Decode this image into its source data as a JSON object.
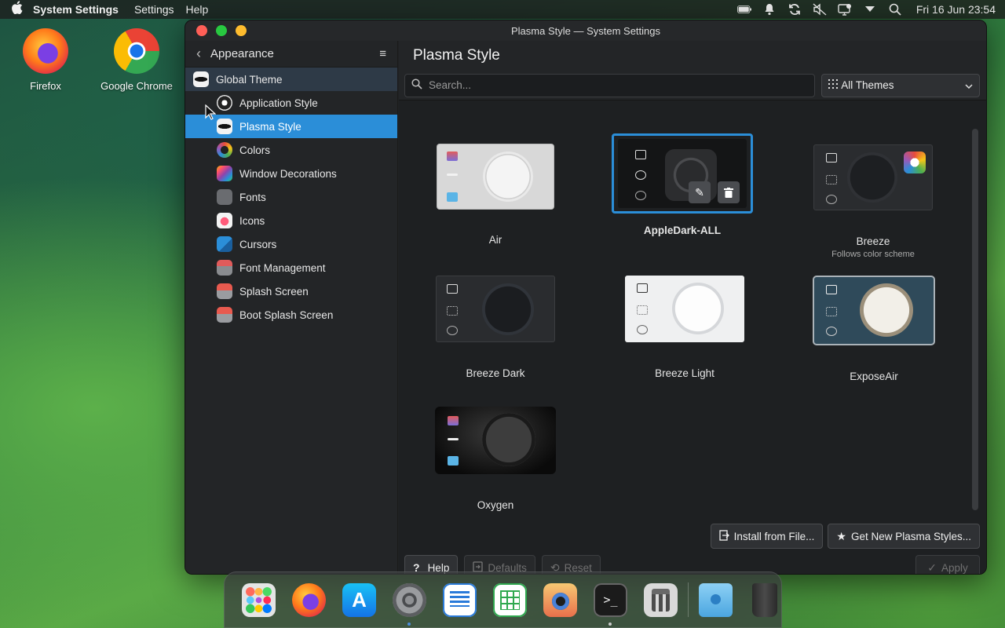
{
  "menubar": {
    "app_name": "System Settings",
    "menus": [
      "Settings",
      "Help"
    ],
    "clock": "Fri 16 Jun 23:54"
  },
  "desktop": {
    "icons": [
      {
        "label": "Firefox"
      },
      {
        "label": "Google Chrome"
      }
    ]
  },
  "window": {
    "title": "Plasma Style — System Settings"
  },
  "sidebar": {
    "header": "Appearance",
    "top_item": "Global Theme",
    "items": [
      {
        "label": "Application Style"
      },
      {
        "label": "Plasma Style"
      },
      {
        "label": "Colors"
      },
      {
        "label": "Window Decorations"
      },
      {
        "label": "Fonts"
      },
      {
        "label": "Icons"
      },
      {
        "label": "Cursors"
      },
      {
        "label": "Font Management"
      },
      {
        "label": "Splash Screen"
      },
      {
        "label": "Boot Splash Screen"
      }
    ],
    "selected": "Plasma Style"
  },
  "main": {
    "title": "Plasma Style",
    "search_placeholder": "Search...",
    "filter": "All Themes",
    "themes": [
      {
        "name": "Air",
        "subtitle": ""
      },
      {
        "name": "AppleDark-ALL",
        "subtitle": ""
      },
      {
        "name": "Breeze",
        "subtitle": "Follows color scheme"
      },
      {
        "name": "Breeze Dark",
        "subtitle": ""
      },
      {
        "name": "Breeze Light",
        "subtitle": ""
      },
      {
        "name": "ExposeAir",
        "subtitle": ""
      },
      {
        "name": "Oxygen",
        "subtitle": ""
      }
    ],
    "selected_theme": "AppleDark-ALL",
    "install_label": "Install from File...",
    "get_new_label": "Get New Plasma Styles...",
    "help_label": "Help",
    "defaults_label": "Defaults",
    "reset_label": "Reset",
    "apply_label": "Apply"
  },
  "colors": {
    "accent": "#2b8ed8",
    "window_bg": "#202224"
  }
}
